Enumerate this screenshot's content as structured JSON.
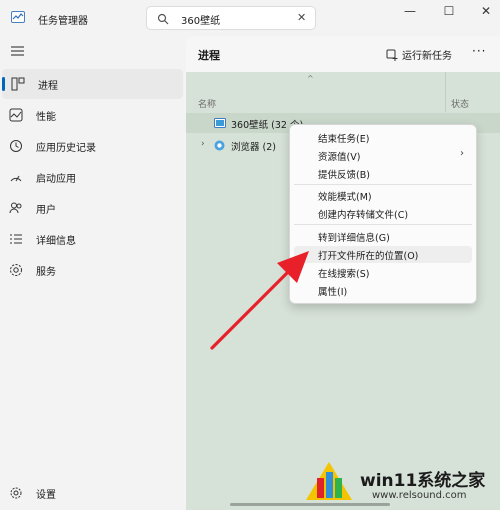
{
  "app": {
    "title": "任务管理器"
  },
  "search": {
    "value": "360壁纸",
    "clear": "✕"
  },
  "window_controls": {
    "minimize": "—",
    "maximize": "☐",
    "close": "✕"
  },
  "sidebar": {
    "items": [
      {
        "label": "进程",
        "icon": "processes-icon",
        "active": true
      },
      {
        "label": "性能",
        "icon": "performance-icon"
      },
      {
        "label": "应用历史记录",
        "icon": "app-history-icon"
      },
      {
        "label": "启动应用",
        "icon": "startup-apps-icon"
      },
      {
        "label": "用户",
        "icon": "users-icon"
      },
      {
        "label": "详细信息",
        "icon": "details-icon"
      },
      {
        "label": "服务",
        "icon": "services-icon"
      }
    ],
    "settings_label": "设置"
  },
  "main": {
    "title": "进程",
    "run_new_task": "运行新任务",
    "more": "···",
    "columns": {
      "name": "名称",
      "status": "状态"
    },
    "rows": [
      {
        "name": "360壁纸 (32 个)",
        "expandable": false
      },
      {
        "name": "浏览器 (2)",
        "expandable": true
      }
    ]
  },
  "context_menu": {
    "groups": [
      [
        {
          "label": "结束任务(E)"
        },
        {
          "label": "资源值(V)",
          "submenu": true
        },
        {
          "label": "提供反馈(B)"
        }
      ],
      [
        {
          "label": "效能模式(M)"
        },
        {
          "label": "创建内存转储文件(C)"
        }
      ],
      [
        {
          "label": "转到详细信息(G)"
        },
        {
          "label": "打开文件所在的位置(O)",
          "highlighted": true
        },
        {
          "label": "在线搜索(S)"
        },
        {
          "label": "属性(I)"
        }
      ]
    ]
  },
  "watermark": {
    "text": "win11系统之家",
    "url": "www.relsound.com"
  },
  "colors": {
    "accent": "#0067c0",
    "arrow": "#e8202a",
    "panel": "#d6e1d7"
  }
}
